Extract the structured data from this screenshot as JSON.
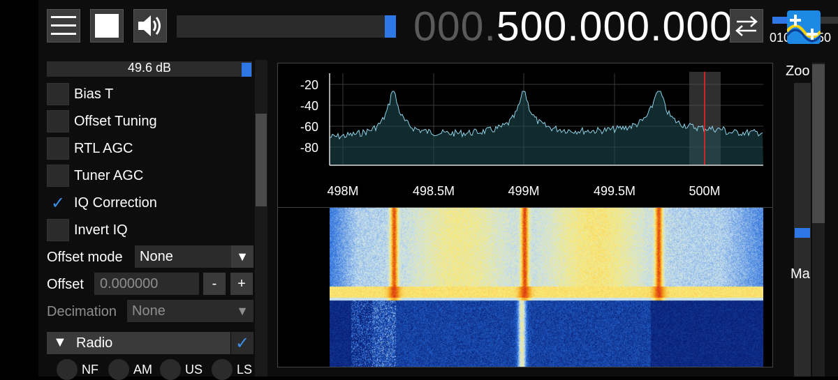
{
  "topbar": {
    "menu_icon": "hamburger-icon",
    "stop_icon": "stop-icon",
    "volume_icon": "speaker-icon",
    "volume_level": 0.95,
    "frequency_dim": "000.",
    "frequency_main": "500.000.000",
    "swap_icon": "swap-arrows-icon",
    "snr_scale_label": "010",
    "snr_scale_label_cut": "50"
  },
  "source_panel": {
    "gain_value": "49.6 dB",
    "options": [
      {
        "label": "Bias T",
        "checked": false
      },
      {
        "label": "Offset Tuning",
        "checked": false
      },
      {
        "label": "RTL AGC",
        "checked": false
      },
      {
        "label": "Tuner AGC",
        "checked": false
      },
      {
        "label": "IQ Correction",
        "checked": true
      },
      {
        "label": "Invert IQ",
        "checked": false
      }
    ],
    "offset_mode_label": "Offset mode",
    "offset_mode_value": "None",
    "offset_label": "Offset",
    "offset_value": "0.000000",
    "minus": "-",
    "plus": "+",
    "decimation_label": "Decimation",
    "decimation_value": "None",
    "checkmark": "✓"
  },
  "radio_section": {
    "title": "Radio",
    "enabled": true,
    "modes": [
      "NF",
      "AM",
      "US",
      "LS"
    ]
  },
  "spectrum": {
    "y_ticks": [
      "-20",
      "-40",
      "-60",
      "-80"
    ],
    "x_ticks": [
      "498M",
      "498.5M",
      "499M",
      "499.5M",
      "500M"
    ]
  },
  "right_panel": {
    "zoom_label": "Zoo",
    "max_label": "Ma",
    "zoom_level": 0.4
  },
  "colors": {
    "accent": "#2e77e6",
    "spectrum_line": "#8fd3e8",
    "tuned_line": "#ff2020"
  }
}
